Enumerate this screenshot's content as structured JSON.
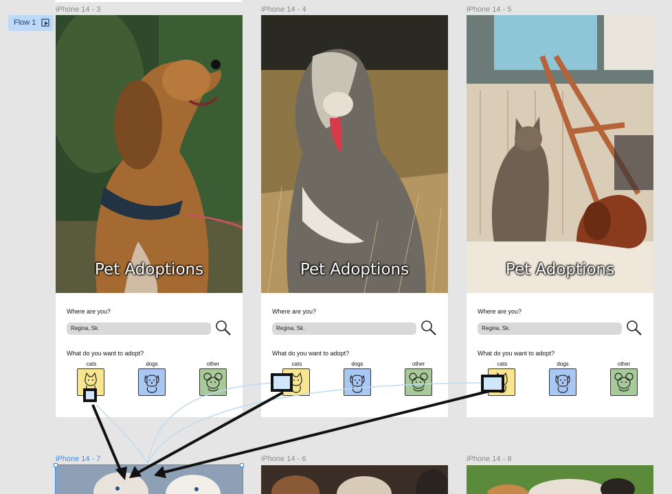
{
  "flow": {
    "label": "Flow 1",
    "icon": "play-flow-icon"
  },
  "frames": [
    {
      "label": "iPhone 14 - 3"
    },
    {
      "label": "iPhone 14 - 4"
    },
    {
      "label": "iPhone 14 - 5"
    },
    {
      "label": "iPhone 14 - 7"
    },
    {
      "label": "iPhone 14 - 6"
    },
    {
      "label": "iPhone 14 - 8"
    }
  ],
  "screen": {
    "title": "Pet Adoptions",
    "where_label": "Where are you?",
    "location_value": "Regina, Sk.",
    "adopt_label": "What do you want to adopt?",
    "categories": [
      {
        "label": "cats",
        "color": "#f7e58f",
        "icon": "cat-icon"
      },
      {
        "label": "dogs",
        "color": "#a9c7f3",
        "icon": "dog-icon"
      },
      {
        "label": "other",
        "color": "#a8c99a",
        "icon": "mouse-icon"
      }
    ]
  },
  "colors": {
    "canvas": "#e5e5e5",
    "selection": "#3b8ef0",
    "connector": "#bcdcf2",
    "arrow": "#111111"
  }
}
